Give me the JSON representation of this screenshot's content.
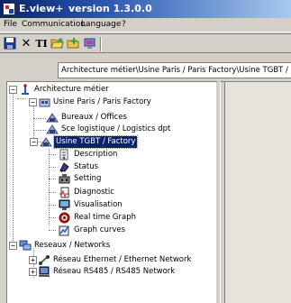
{
  "window": {
    "app_name": "E.view+",
    "version": "version 1.3.0.0"
  },
  "menu": [
    "File",
    "Communication",
    "Language",
    "?"
  ],
  "toolbar": {
    "icons": [
      "save-icon",
      "delete-icon",
      "text-icon",
      "open-folder-icon",
      "add-icon",
      "connect-icon"
    ],
    "delete_glyph": "✕",
    "text_glyph": "TI"
  },
  "address": {
    "path": "Architecture métier\\Usine Paris / Paris Factory\\Usine TGBT / Factory\\Usine TGBT / Factory"
  },
  "tree": {
    "root": {
      "label": "Architecture métier",
      "expander": "−"
    },
    "factory": {
      "label": "Usine Paris / Paris Factory",
      "expander": "−"
    },
    "offices": {
      "label": "Bureaux / Offices"
    },
    "logistics": {
      "label": "Sce logistique / Logistics dpt"
    },
    "tgbt": {
      "label": "Usine TGBT  / Factory",
      "expander": "−"
    },
    "items": [
      {
        "label": "Description",
        "icon": "description-icon"
      },
      {
        "label": "Status",
        "icon": "status-icon"
      },
      {
        "label": "Setting",
        "icon": "setting-icon"
      },
      {
        "label": "Diagnostic",
        "icon": "diagnostic-icon"
      },
      {
        "label": "Visualisation",
        "icon": "visualisation-icon"
      },
      {
        "label": "Real time Graph",
        "icon": "realtime-graph-icon"
      },
      {
        "label": "Graph curves",
        "icon": "graph-curves-icon"
      }
    ],
    "networks": {
      "label": "Reseaux / Networks",
      "expander": "−"
    },
    "ethernet": {
      "label": "Réseau Ethernet / Ethernet Network",
      "expander": "+"
    },
    "rs485": {
      "label": "Réseau RS485 / RS485 Network",
      "expander": "+"
    }
  },
  "colors": {
    "title_dark": "#0a2468",
    "selection": "#0a246a",
    "chrome": "#d4d0c8"
  }
}
